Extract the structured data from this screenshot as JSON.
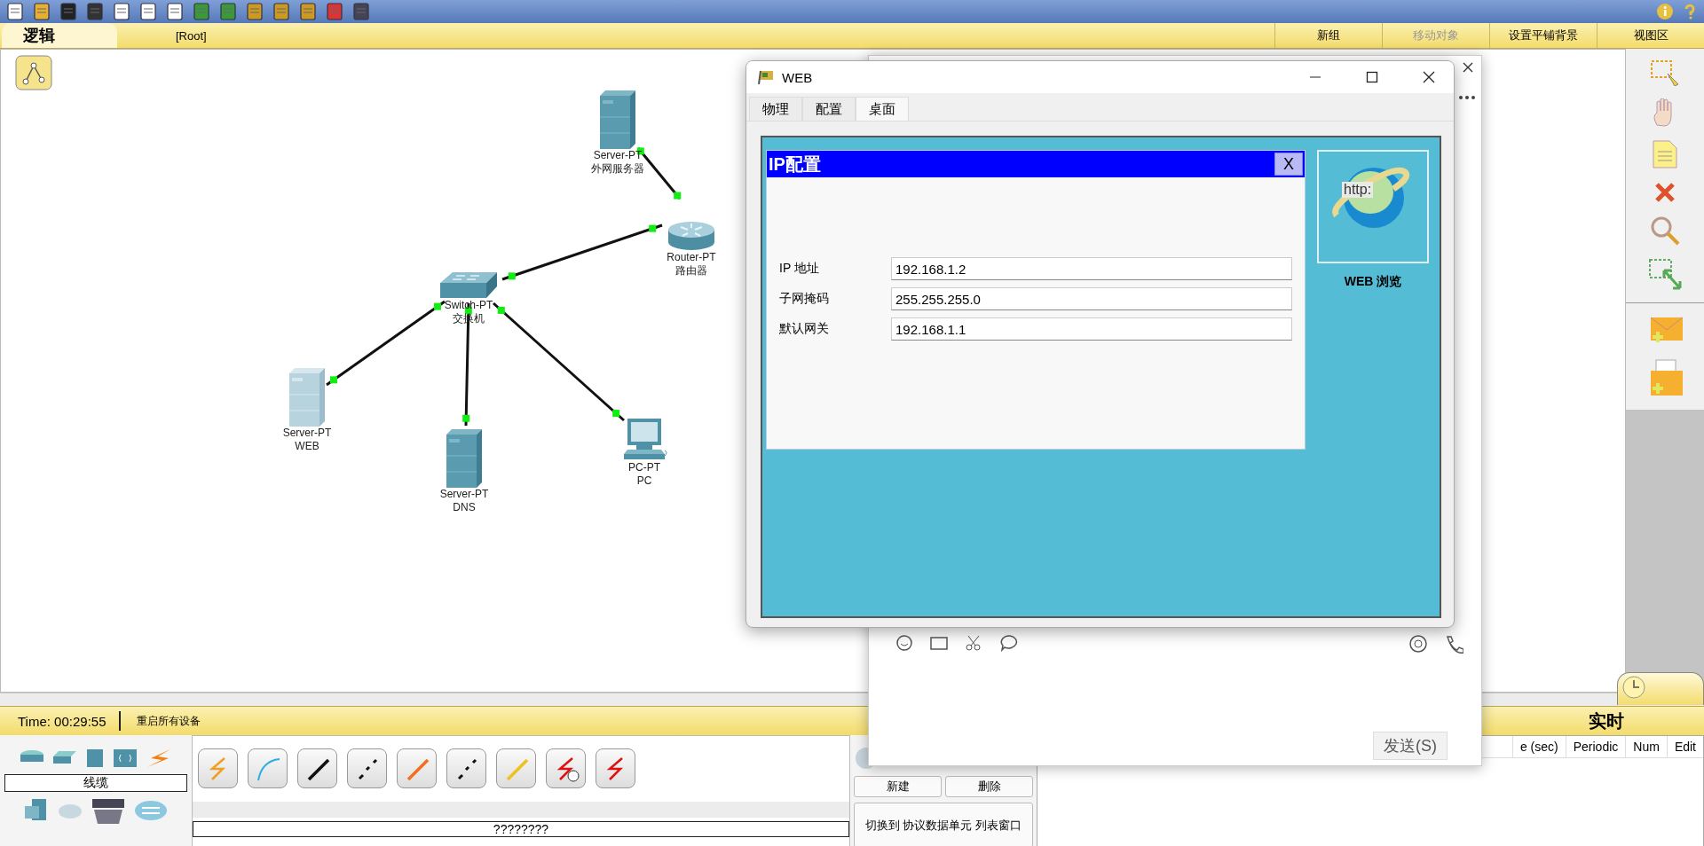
{
  "header_bar": {
    "tab": "逻辑",
    "path": "[Root]",
    "actions": [
      {
        "label": "新组",
        "disabled": false
      },
      {
        "label": "移动对象",
        "disabled": true
      },
      {
        "label": "设置平铺背景",
        "disabled": false
      },
      {
        "label": "视图区",
        "disabled": false
      }
    ]
  },
  "canvas": {
    "nodes": [
      {
        "kind": "server",
        "model": "Server-PT",
        "name": "外网服务器"
      },
      {
        "kind": "router",
        "model": "Router-PT",
        "name": "路由器"
      },
      {
        "kind": "switch",
        "model": "Switch-PT",
        "name": "交换机"
      },
      {
        "kind": "server-light",
        "model": "Server-PT",
        "name": "WEB"
      },
      {
        "kind": "server",
        "model": "Server-PT",
        "name": "DNS"
      },
      {
        "kind": "pc",
        "model": "PC-PT",
        "name": "PC"
      }
    ]
  },
  "web_window": {
    "title": "WEB",
    "tabs": [
      {
        "label": "物理",
        "selected": false
      },
      {
        "label": "配置",
        "selected": false
      },
      {
        "label": "桌面",
        "selected": true
      }
    ],
    "ip_config": {
      "title": "IP配置",
      "close": "X",
      "fields": [
        {
          "label": "IP 地址",
          "value": "192.168.1.2"
        },
        {
          "label": "子网掩码",
          "value": "255.255.255.0"
        },
        {
          "label": "默认网关",
          "value": "192.168.1.1"
        }
      ]
    },
    "apps": [
      {
        "label": "WEB 浏览",
        "icon_text": "http:"
      }
    ]
  },
  "chat_window": {
    "send_button": "发送(S)"
  },
  "status_bar": {
    "time": "Time: 00:29:55",
    "reset": "重启所有设备",
    "mode": "实时"
  },
  "device_panel": {
    "category": "线缆",
    "caption": "????????"
  },
  "pdu_panel": {
    "buttons": [
      "新建",
      "删除"
    ],
    "toggle": "切换到 协议数据单元 列表窗口"
  },
  "event_table": {
    "columns": [
      "e (sec)",
      "Periodic",
      "Num",
      "Edit"
    ]
  }
}
